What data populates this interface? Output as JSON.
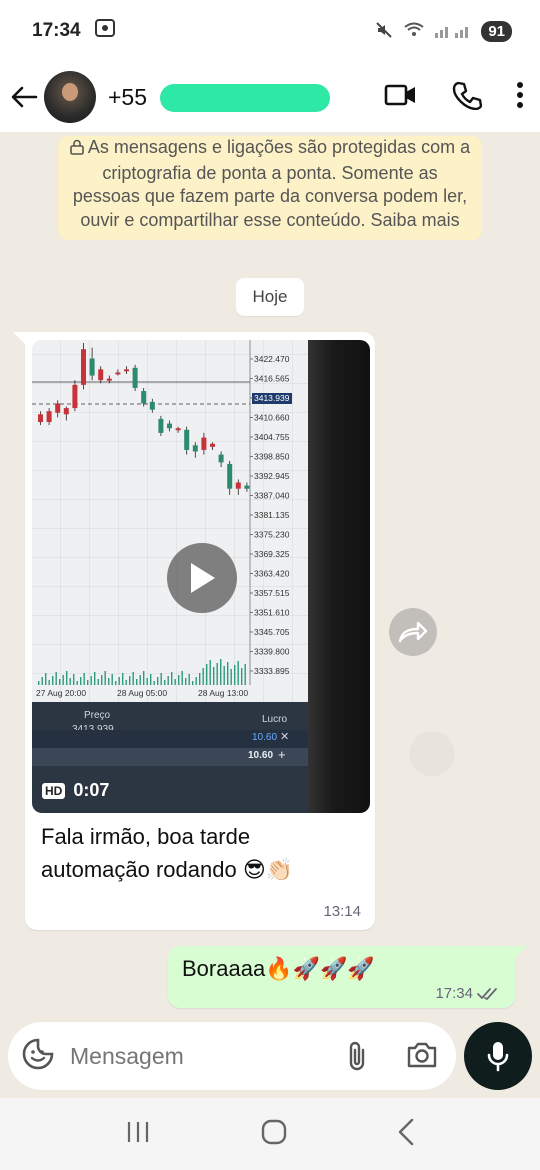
{
  "status_bar": {
    "time": "17:34",
    "battery": "91"
  },
  "header": {
    "contact_name": "+55"
  },
  "encryption_notice": "As mensagens e ligações são protegidas com a criptografia de ponta a ponta. Somente as pessoas que fazem parte da conversa podem ler, ouvir e compartilhar esse conteúdo. Saiba mais",
  "date_chip": "Hoje",
  "incoming": {
    "video_quality": "HD",
    "video_duration": "0:07",
    "caption_line1": "Fala irmão, boa tarde",
    "caption_line2": "automação rodando 😎👏🏻",
    "time": "13:14",
    "chart": {
      "price_labels": [
        "3422.470",
        "3416.565",
        "3413.939",
        "3410.660",
        "3404.755",
        "3398.850",
        "3392.945",
        "3387.040",
        "3381.135",
        "3375.230",
        "3369.325",
        "3363.420",
        "3357.515",
        "3351.610",
        "3345.705",
        "3339.800",
        "3333.895"
      ],
      "time_labels": [
        "27 Aug 20:00",
        "28 Aug 05:00",
        "28 Aug 13:00"
      ],
      "panel_price_label": "Preço",
      "panel_price_value": "3413.939",
      "panel_profit_label": "Lucro",
      "panel_profit_row1": "10.60",
      "panel_profit_row2": "10.60"
    }
  },
  "outgoing": {
    "text": "Boraaaa🔥🚀🚀🚀",
    "time": "17:34"
  },
  "composer": {
    "placeholder": "Mensagem"
  },
  "colors": {
    "header_bg": "#ffffff",
    "chat_bg": "#efeae2",
    "outgoing_bubble": "#d9fdd3",
    "encryption_bg": "#fdf1c8",
    "mic_button": "#0f1d1c"
  }
}
